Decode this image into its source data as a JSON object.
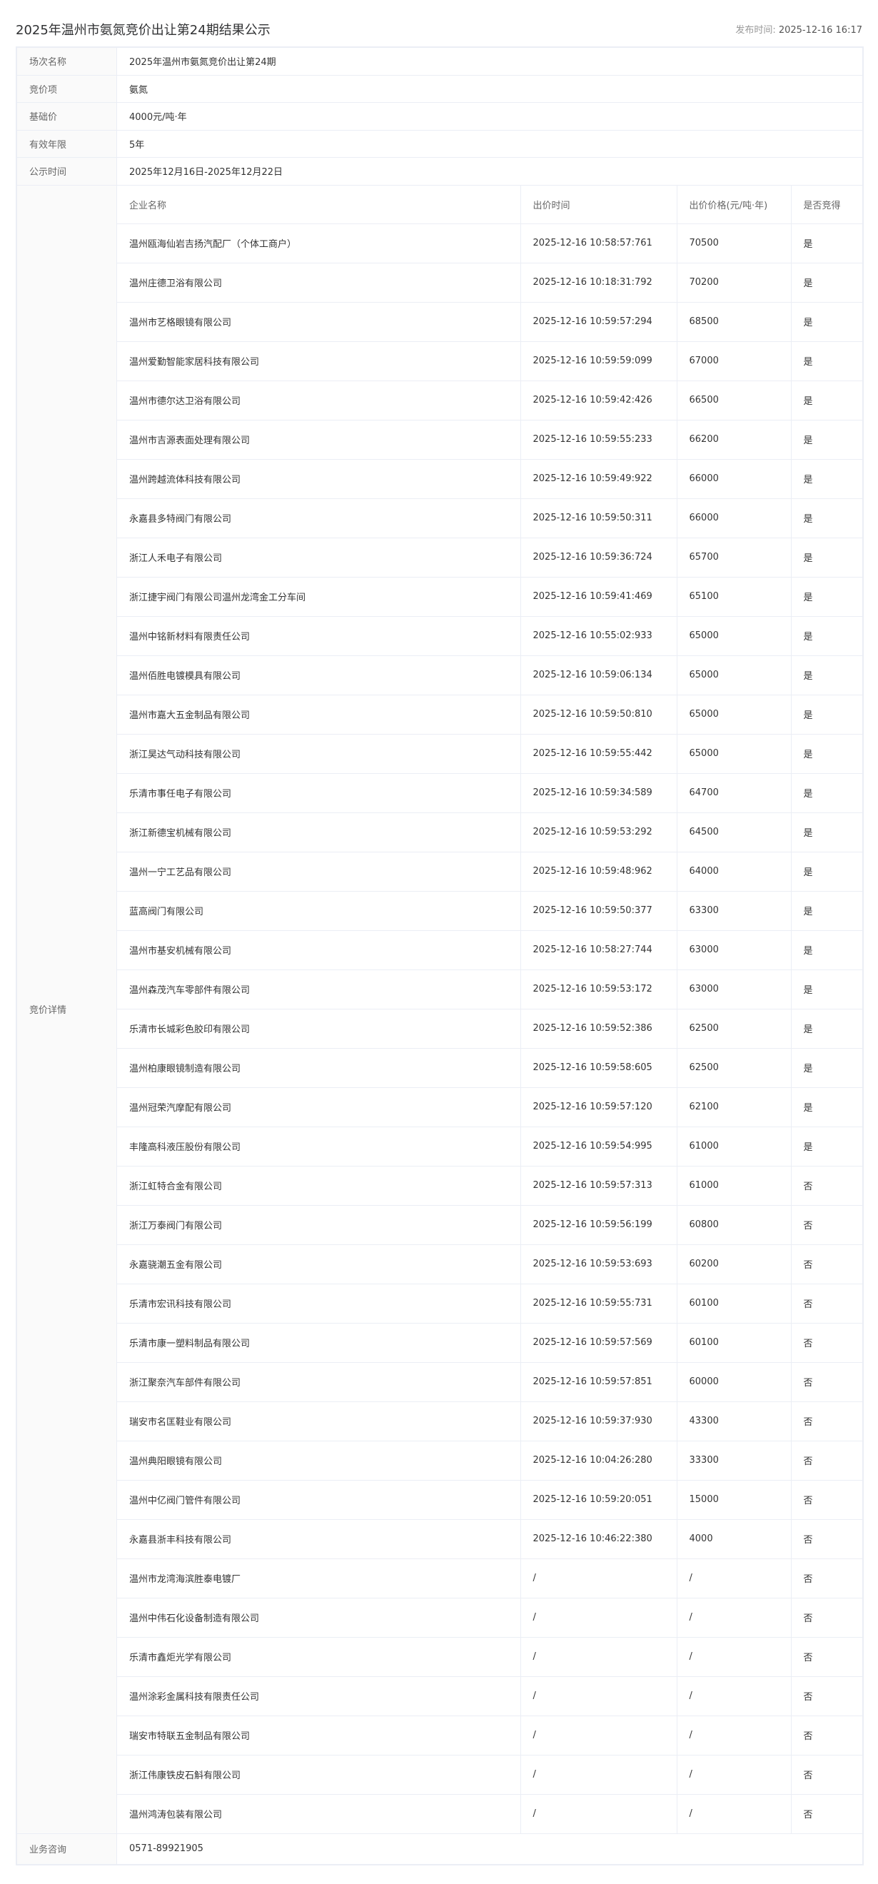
{
  "header": {
    "title": "2025年温州市氨氮竞价出让第24期结果公示",
    "publish_label": "发布时间:",
    "publish_time": "2025-12-16 16:17"
  },
  "info": [
    {
      "label": "场次名称",
      "value": "2025年温州市氨氮竞价出让第24期"
    },
    {
      "label": "竞价项",
      "value": "氨氮"
    },
    {
      "label": "基础价",
      "value": "4000元/吨·年"
    },
    {
      "label": "有效年限",
      "value": "5年"
    },
    {
      "label": "公示时间",
      "value": "2025年12月16日-2025年12月22日"
    }
  ],
  "detail": {
    "label": "竞价详情",
    "columns": [
      "企业名称",
      "出价时间",
      "出价价格(元/吨·年)",
      "是否竞得"
    ],
    "rows": [
      [
        "温州瓯海仙岩吉扬汽配厂（个体工商户）",
        "2025-12-16 10:58:57:761",
        "70500",
        "是"
      ],
      [
        "温州庄德卫浴有限公司",
        "2025-12-16 10:18:31:792",
        "70200",
        "是"
      ],
      [
        "温州市艺格眼镜有限公司",
        "2025-12-16 10:59:57:294",
        "68500",
        "是"
      ],
      [
        "温州爱勤智能家居科技有限公司",
        "2025-12-16 10:59:59:099",
        "67000",
        "是"
      ],
      [
        "温州市德尔达卫浴有限公司",
        "2025-12-16 10:59:42:426",
        "66500",
        "是"
      ],
      [
        "温州市吉源表面处理有限公司",
        "2025-12-16 10:59:55:233",
        "66200",
        "是"
      ],
      [
        "温州跨越流体科技有限公司",
        "2025-12-16 10:59:49:922",
        "66000",
        "是"
      ],
      [
        "永嘉县多特阀门有限公司",
        "2025-12-16 10:59:50:311",
        "66000",
        "是"
      ],
      [
        "浙江人禾电子有限公司",
        "2025-12-16 10:59:36:724",
        "65700",
        "是"
      ],
      [
        "浙江捷宇阀门有限公司温州龙湾金工分车间",
        "2025-12-16 10:59:41:469",
        "65100",
        "是"
      ],
      [
        "温州中铭新材料有限责任公司",
        "2025-12-16 10:55:02:933",
        "65000",
        "是"
      ],
      [
        "温州佰胜电镀模具有限公司",
        "2025-12-16 10:59:06:134",
        "65000",
        "是"
      ],
      [
        "温州市嘉大五金制品有限公司",
        "2025-12-16 10:59:50:810",
        "65000",
        "是"
      ],
      [
        "浙江昊达气动科技有限公司",
        "2025-12-16 10:59:55:442",
        "65000",
        "是"
      ],
      [
        "乐清市事任电子有限公司",
        "2025-12-16 10:59:34:589",
        "64700",
        "是"
      ],
      [
        "浙江新德宝机械有限公司",
        "2025-12-16 10:59:53:292",
        "64500",
        "是"
      ],
      [
        "温州一宁工艺品有限公司",
        "2025-12-16 10:59:48:962",
        "64000",
        "是"
      ],
      [
        "蓝高阀门有限公司",
        "2025-12-16 10:59:50:377",
        "63300",
        "是"
      ],
      [
        "温州市基安机械有限公司",
        "2025-12-16 10:58:27:744",
        "63000",
        "是"
      ],
      [
        "温州森茂汽车零部件有限公司",
        "2025-12-16 10:59:53:172",
        "63000",
        "是"
      ],
      [
        "乐清市长城彩色胶印有限公司",
        "2025-12-16 10:59:52:386",
        "62500",
        "是"
      ],
      [
        "温州柏康眼镜制造有限公司",
        "2025-12-16 10:59:58:605",
        "62500",
        "是"
      ],
      [
        "温州冠荣汽摩配有限公司",
        "2025-12-16 10:59:57:120",
        "62100",
        "是"
      ],
      [
        "丰隆高科液压股份有限公司",
        "2025-12-16 10:59:54:995",
        "61000",
        "是"
      ],
      [
        "浙江虹特合金有限公司",
        "2025-12-16 10:59:57:313",
        "61000",
        "否"
      ],
      [
        "浙江万泰阀门有限公司",
        "2025-12-16 10:59:56:199",
        "60800",
        "否"
      ],
      [
        "永嘉骁潮五金有限公司",
        "2025-12-16 10:59:53:693",
        "60200",
        "否"
      ],
      [
        "乐清市宏讯科技有限公司",
        "2025-12-16 10:59:55:731",
        "60100",
        "否"
      ],
      [
        "乐清市康一塑料制品有限公司",
        "2025-12-16 10:59:57:569",
        "60100",
        "否"
      ],
      [
        "浙江聚奈汽车部件有限公司",
        "2025-12-16 10:59:57:851",
        "60000",
        "否"
      ],
      [
        "瑞安市名匡鞋业有限公司",
        "2025-12-16 10:59:37:930",
        "43300",
        "否"
      ],
      [
        "温州典阳眼镜有限公司",
        "2025-12-16 10:04:26:280",
        "33300",
        "否"
      ],
      [
        "温州中亿阀门管件有限公司",
        "2025-12-16 10:59:20:051",
        "15000",
        "否"
      ],
      [
        "永嘉县浙丰科技有限公司",
        "2025-12-16 10:46:22:380",
        "4000",
        "否"
      ],
      [
        "温州市龙湾海滨胜泰电镀厂",
        "/",
        "/",
        "否"
      ],
      [
        "温州中伟石化设备制造有限公司",
        "/",
        "/",
        "否"
      ],
      [
        "乐清市鑫炬光学有限公司",
        "/",
        "/",
        "否"
      ],
      [
        "温州涂彩金属科技有限责任公司",
        "/",
        "/",
        "否"
      ],
      [
        "瑞安市特联五金制品有限公司",
        "/",
        "/",
        "否"
      ],
      [
        "浙江伟康铁皮石斛有限公司",
        "/",
        "/",
        "否"
      ],
      [
        "温州鸿涛包装有限公司",
        "/",
        "/",
        "否"
      ]
    ]
  },
  "consult": {
    "label": "业务咨询",
    "value": "0571-89921905"
  }
}
